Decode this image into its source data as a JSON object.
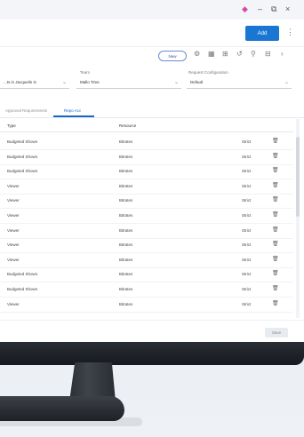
{
  "titlebar": {
    "min": "–",
    "max": "⧉",
    "close": "×"
  },
  "header": {
    "add_label": "Add",
    "more": "⋮"
  },
  "toolbar": {
    "pill_label": "New"
  },
  "filters": [
    {
      "label": "",
      "value": "...ts in Jacquelin G"
    },
    {
      "label": "Team",
      "value": "Mallo Time"
    },
    {
      "label": "Request Configuration",
      "value": "Default"
    }
  ],
  "tabs": [
    {
      "label": "Approval Requirements"
    },
    {
      "label": "Repo Acc"
    }
  ],
  "table": {
    "columns": [
      "Type",
      "Resource"
    ],
    "rows": [
      {
        "type": "Budgeted Shown",
        "resource": "Bitrates",
        "action": "Strict"
      },
      {
        "type": "Budgeted Shown",
        "resource": "Bitrates",
        "action": "Strict"
      },
      {
        "type": "Budgeted Shown",
        "resource": "Bitrates",
        "action": "Strict"
      },
      {
        "type": "Viewer",
        "resource": "Bitrates",
        "action": "Strict"
      },
      {
        "type": "Viewer",
        "resource": "Bitrates",
        "action": "Strict"
      },
      {
        "type": "Viewer",
        "resource": "Bitrates",
        "action": "Strict"
      },
      {
        "type": "Viewer",
        "resource": "Bitrates",
        "action": "Strict"
      },
      {
        "type": "Viewer",
        "resource": "Bitrates",
        "action": "Strict"
      },
      {
        "type": "Viewer",
        "resource": "Bitrates",
        "action": "Strict"
      },
      {
        "type": "Budgeted Shown",
        "resource": "Bitrates",
        "action": "Strict"
      },
      {
        "type": "Budgeted Shown",
        "resource": "Bitrates",
        "action": "Strict"
      },
      {
        "type": "Viewer",
        "resource": "Bitrates",
        "action": "Strict"
      }
    ]
  },
  "footer": {
    "save_label": "Save"
  },
  "colors": {
    "accent": "#1976d2",
    "tab_active": "#1a66c8"
  },
  "icons": [
    "settings-icon",
    "grid-icon",
    "filter-icon",
    "history-icon",
    "link-icon",
    "export-icon",
    "share-icon"
  ]
}
